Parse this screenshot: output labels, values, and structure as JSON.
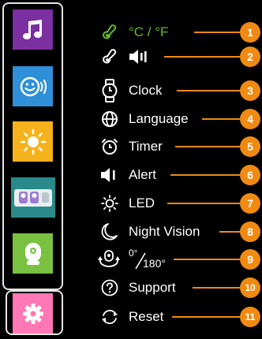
{
  "sidebar": {
    "items": [
      {
        "name": "music",
        "icon": "music-note-icon",
        "color": "#7b2fa0"
      },
      {
        "name": "voice",
        "icon": "smiley-voice-icon",
        "color": "#2f8fd8"
      },
      {
        "name": "light",
        "icon": "sun-icon",
        "color": "#f5b21c"
      },
      {
        "name": "cameras",
        "icon": "camera-units-icon",
        "color": "#2a8a8a"
      },
      {
        "name": "camera",
        "icon": "camera-icon",
        "color": "#7ac142"
      },
      {
        "name": "settings",
        "icon": "gear-icon",
        "color": "#ff77b4"
      }
    ]
  },
  "menu": {
    "items": [
      {
        "label": "°C / °F",
        "badge": "1",
        "icon": "thermometer-icon"
      },
      {
        "label": "",
        "badge": "2",
        "icon": "speaker-volume-icon"
      },
      {
        "label": "Clock",
        "badge": "3",
        "icon": "watch-icon"
      },
      {
        "label": "Language",
        "badge": "4",
        "icon": "globe-icon"
      },
      {
        "label": "Timer",
        "badge": "5",
        "icon": "alarm-clock-icon"
      },
      {
        "label": "Alert",
        "badge": "6",
        "icon": "speaker-icon"
      },
      {
        "label": "LED",
        "badge": "7",
        "icon": "sun-outline-icon"
      },
      {
        "label": "Night Vision",
        "badge": "8",
        "icon": "moon-icon"
      },
      {
        "label": "",
        "badge": "9",
        "icon": "camera-rotate-icon",
        "rotation": {
          "from": "0°",
          "to": "180°"
        }
      },
      {
        "label": "Support",
        "badge": "10",
        "icon": "question-icon"
      },
      {
        "label": "Reset",
        "badge": "11",
        "icon": "reset-icon"
      }
    ]
  },
  "colors": {
    "accent": "#f08a12",
    "units_green": "#5cbf2a"
  }
}
